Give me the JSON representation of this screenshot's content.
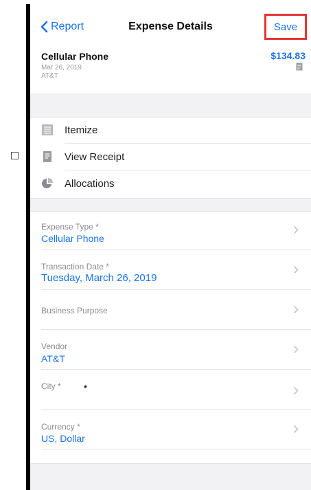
{
  "nav": {
    "back_label": "Report",
    "title": "Expense Details",
    "save_label": "Save"
  },
  "summary": {
    "merchant": "Cellular Phone",
    "date": "Mar 26, 2019",
    "vendor": "AT&T",
    "amount": "$134.83"
  },
  "actions": [
    {
      "label": "Itemize",
      "icon": "list-icon"
    },
    {
      "label": "View Receipt",
      "icon": "receipt-icon"
    },
    {
      "label": "Allocations",
      "icon": "pie-chart-icon"
    }
  ],
  "fields": [
    {
      "label": "Expense Type *",
      "value": "Cellular Phone"
    },
    {
      "label": "Transaction Date *",
      "value": "Tuesday, March 26, 2019"
    },
    {
      "label": "Business Purpose",
      "value": ""
    },
    {
      "label": "Vendor",
      "value": "AT&T"
    },
    {
      "label": "City *",
      "value": "•"
    },
    {
      "label": "Currency *",
      "value": "US, Dollar"
    }
  ],
  "colors": {
    "accent": "#1a73e8",
    "highlight": "#e53333"
  }
}
